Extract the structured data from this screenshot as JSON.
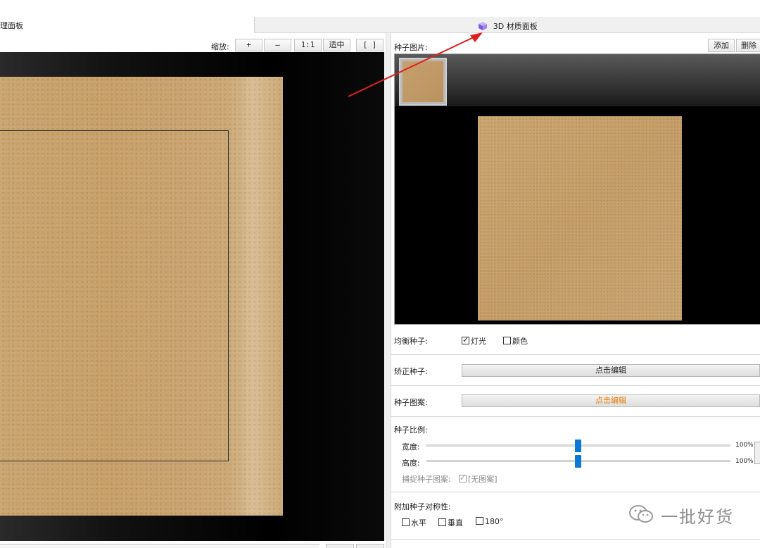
{
  "tabs": {
    "left_label": "理面板",
    "right_label": "3D 材质面板"
  },
  "zoom": {
    "label": "缩放:",
    "plus": "+",
    "minus": "—",
    "one_to_one": "1:1",
    "fit": "适中",
    "bracket": "[ ]"
  },
  "seed_panel": {
    "seed_images_label": "种子图片:",
    "add_label": "添加",
    "delete_label": "删除",
    "balance_label": "均衡种子:",
    "light_label": "灯光",
    "light_checked": true,
    "color_label": "颜色",
    "color_checked": false,
    "correct_label": "矫正种子:",
    "correct_button": "点击编辑",
    "pattern_label": "种子图案:",
    "pattern_button": "点击编辑",
    "pattern_button_color": "#e87a00",
    "ratio_label": "种子比例:",
    "width_label": "宽度:",
    "width_value": "100%",
    "width_fraction": 0.5,
    "height_label": "高度:",
    "height_value": "100%",
    "height_fraction": 0.5,
    "capture_label": "捕捉种子图案:",
    "capture_value": "[无图案]",
    "capture_checked": true,
    "symmetry_label": "附加种子对称性:",
    "horizontal_label": "水平",
    "vertical_label": "垂直",
    "rotate_label": "180°",
    "accent_color": "#0a78d7"
  },
  "watermark": {
    "text": "一批好货"
  }
}
